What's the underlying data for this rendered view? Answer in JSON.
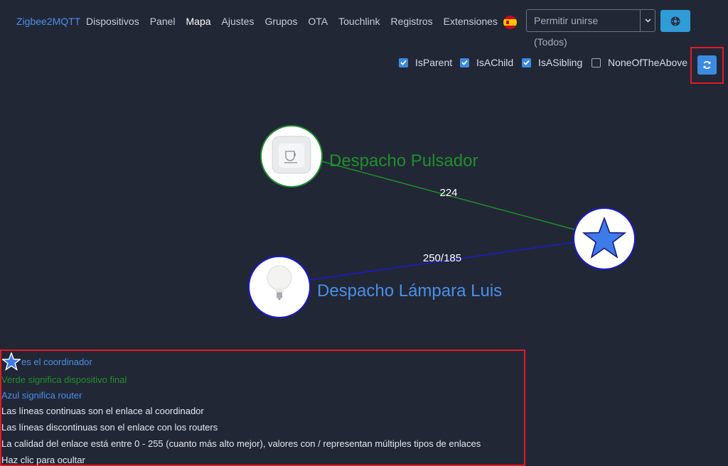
{
  "navbar": {
    "brand": "Zigbee2MQTT",
    "items": [
      "Dispositivos",
      "Panel",
      "Mapa",
      "Ajustes",
      "Grupos",
      "OTA",
      "Touchlink",
      "Registros",
      "Extensiones"
    ],
    "active": "Mapa",
    "language_flag_icon": "spain-flag-icon",
    "permit_join_label": "Permitir unirse (Todos)",
    "dropdown_icon": "chevron-down-icon",
    "extra_button_icon": "settings-icon"
  },
  "filters": [
    {
      "label": "IsParent",
      "checked": true
    },
    {
      "label": "IsAChild",
      "checked": true
    },
    {
      "label": "IsASibling",
      "checked": true
    },
    {
      "label": "NoneOfTheAbove",
      "checked": false
    }
  ],
  "refresh_icon": "refresh-icon",
  "map": {
    "nodes": [
      {
        "label": "Despacho Pulsador",
        "kind": "end-device",
        "icon": "button-device-icon",
        "color": "#1f8f2a"
      },
      {
        "label": "Despacho Lámpara Luis",
        "kind": "router",
        "icon": "bulb-icon",
        "color": "#4a8fe7"
      },
      {
        "label": "",
        "kind": "coordinator",
        "icon": "star-icon",
        "color": "#3d7be8"
      }
    ],
    "links": [
      {
        "label": "224",
        "color": "#1f8f2a"
      },
      {
        "label": "250/185",
        "color": "#1a1ad1"
      }
    ]
  },
  "legend": {
    "coordinator": "es el coordinador",
    "green": "Verde significa dispositivo final",
    "blue": "Azul significa router",
    "solid": "Las líneas continuas son el enlace al coordinador",
    "dashed": "Las líneas discontinuas son el enlace con los routers",
    "quality": "La calidad del enlace está entre 0 - 255 (cuanto más alto mejor), valores con / representan múltiples tipos de enlaces",
    "hide": "Haz clic para ocultar"
  },
  "colors": {
    "background": "#222736",
    "accent": "#3d8be0",
    "end_device": "#1f8f2a",
    "router": "#4a8fe7",
    "highlight": "#e01b24"
  }
}
